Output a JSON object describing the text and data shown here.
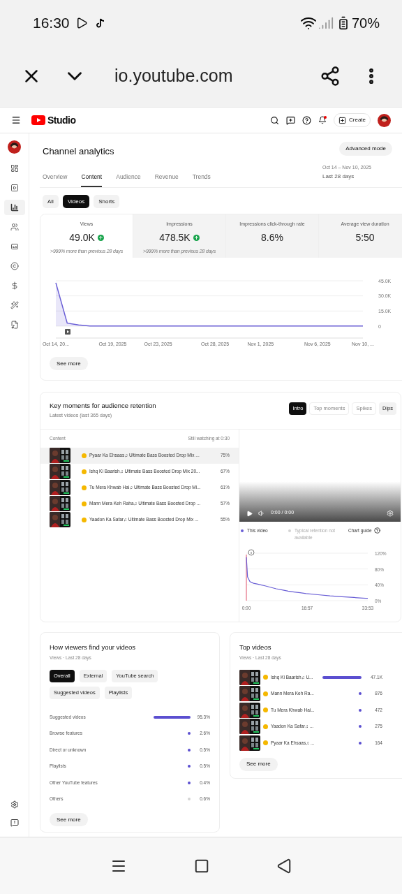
{
  "status_bar": {
    "time": "16:30",
    "battery": "70%"
  },
  "browser": {
    "url": "io.youtube.com"
  },
  "studio": {
    "logo": "Studio",
    "create": "Create"
  },
  "sidebar": {
    "items": [
      {
        "selected": false
      },
      {
        "selected": false
      },
      {
        "selected": true
      },
      {
        "selected": false
      },
      {
        "selected": false
      },
      {
        "selected": false
      },
      {
        "selected": false
      },
      {
        "selected": false
      },
      {
        "selected": false
      }
    ]
  },
  "page": {
    "title": "Channel analytics",
    "advanced": "Advanced mode",
    "date_range": "Oct 14 – Nov 10, 2025",
    "period": "Last 28 days"
  },
  "tabs": [
    {
      "label": "Overview",
      "selected": false
    },
    {
      "label": "Content",
      "selected": true
    },
    {
      "label": "Audience",
      "selected": false
    },
    {
      "label": "Revenue",
      "selected": false
    },
    {
      "label": "Trends",
      "selected": false
    }
  ],
  "filters": [
    {
      "label": "All",
      "selected": false
    },
    {
      "label": "Videos",
      "selected": true
    },
    {
      "label": "Shorts",
      "selected": false
    }
  ],
  "metrics": [
    {
      "label": "Views",
      "value": "49.0K",
      "up": true,
      "note": ">999% more than previous 28 days",
      "selected": true
    },
    {
      "label": "Impressions",
      "value": "478.5K",
      "up": true,
      "note": ">999% more than previous 28 days",
      "selected": false
    },
    {
      "label": "Impressions click-through rate",
      "value": "8.6%",
      "up": false,
      "selected": false
    },
    {
      "label": "Average view duration",
      "value": "5:50",
      "up": false,
      "selected": false
    }
  ],
  "views_chart": {
    "see_more": "See more",
    "chart_data": {
      "type": "area",
      "categories": [
        "Oct 14, 20...",
        null,
        null,
        null,
        null,
        "Oct 19, 2025",
        null,
        null,
        null,
        "Oct 23, 2025",
        null,
        null,
        null,
        null,
        "Oct 28, 2025",
        null,
        null,
        null,
        "Nov 1, 2025",
        null,
        null,
        null,
        null,
        "Nov 6, 2025",
        null,
        null,
        null,
        "Nov 10, ..."
      ],
      "series": [
        {
          "color": "#6a5fd6",
          "values": [
            43000,
            3000,
            1200,
            200,
            100,
            100,
            100,
            100,
            100,
            100,
            100,
            100,
            100,
            100,
            100,
            100,
            100,
            100,
            100,
            100,
            100,
            100,
            100,
            100,
            100,
            100,
            100,
            100
          ]
        }
      ],
      "ylim": [
        0,
        45000
      ],
      "yticks": [
        {
          "value": 0,
          "label": "0"
        },
        {
          "value": 15000,
          "label": "15.0K"
        },
        {
          "value": 30000,
          "label": "30.0K"
        },
        {
          "value": 45000,
          "label": "45.0K"
        }
      ]
    }
  },
  "retention": {
    "title": "Key moments for audience retention",
    "subtitle": "Latest videos (last 365 days)",
    "chips": [
      {
        "label": "Intro",
        "selected": true,
        "kind": "outlined"
      },
      {
        "label": "Top moments",
        "selected": false,
        "kind": "outlined"
      },
      {
        "label": "Spikes",
        "selected": false,
        "kind": "outlined"
      },
      {
        "label": "Dips",
        "selected": false,
        "kind": "filled"
      }
    ],
    "columns": [
      "Content",
      "Still watching at 0:30"
    ],
    "rows": [
      {
        "title": "Pyaar Ka Ehsaas♫ Ultimate Bass Boosted Drop Mix ...",
        "value": "75%",
        "selected": true
      },
      {
        "title": "Ishq Ki Baarish♫ Ultimate Bass Boosted Drop Mix 20...",
        "value": "67%",
        "selected": false
      },
      {
        "title": "Tu Mera Khwab Hai♫ Ultimate Bass Boosted Drop Mi...",
        "value": "61%",
        "selected": false
      },
      {
        "title": "Mann Mera Keh Raha♫ Ultimate Bass Boosted Drop ...",
        "value": "57%",
        "selected": false
      },
      {
        "title": "Yaadon Ka Safar♫ Ultimate Bass Boosted Drop Mix ...",
        "value": "55%",
        "selected": false
      }
    ],
    "player_time": "0:00 / 0:00",
    "legend_unavailable": "Typical retention not available",
    "chart_guide": "Chart guide",
    "chart_data": {
      "type": "line",
      "x": [
        0,
        20,
        60,
        120,
        180,
        240,
        300,
        400,
        500,
        600,
        700,
        800,
        900,
        1000,
        1200,
        1400,
        1600,
        1800,
        1900,
        2000,
        2033
      ],
      "series": [
        {
          "name": "This video",
          "color": "#6a5fd6",
          "values": [
            110,
            60,
            48,
            44,
            42,
            40,
            38,
            34,
            30,
            27,
            24,
            22,
            20,
            18,
            15,
            12,
            10,
            8,
            7,
            6,
            6
          ]
        }
      ],
      "ylim": [
        0,
        120
      ],
      "yticks": [
        {
          "value": 0,
          "label": "0%"
        },
        {
          "value": 40,
          "label": "40%"
        },
        {
          "value": 80,
          "label": "80%"
        },
        {
          "value": 120,
          "label": "120%"
        }
      ],
      "xlim": [
        0,
        2033
      ],
      "xticks": [
        {
          "value": 0,
          "label": "0:00"
        },
        {
          "value": 1017,
          "label": "16:57"
        },
        {
          "value": 2033,
          "label": "33:53"
        }
      ]
    }
  },
  "traffic": {
    "title": "How viewers find your videos",
    "subtitle": "Views · Last 28 days",
    "chips": [
      {
        "label": "Overall",
        "selected": true
      },
      {
        "label": "External",
        "selected": false
      },
      {
        "label": "YouTube search",
        "selected": false
      },
      {
        "label": "Suggested videos",
        "selected": false
      },
      {
        "label": "Playlists",
        "selected": false
      }
    ],
    "rows": [
      {
        "label": "Suggested videos",
        "value": "95.3%",
        "kind": "bar",
        "color": "#5b4fd0"
      },
      {
        "label": "Browse features",
        "value": "2.6%",
        "kind": "dot",
        "color": "#5b4fd0"
      },
      {
        "label": "Direct or unknown",
        "value": "0.5%",
        "kind": "dot",
        "color": "#5b4fd0"
      },
      {
        "label": "Playlists",
        "value": "0.5%",
        "kind": "dot",
        "color": "#5b4fd0"
      },
      {
        "label": "Other YouTube features",
        "value": "0.4%",
        "kind": "dot",
        "color": "#5b4fd0"
      },
      {
        "label": "Others",
        "value": "0.6%",
        "kind": "dot",
        "color": "#d4d4d4"
      }
    ],
    "see_more": "See more"
  },
  "top_videos": {
    "title": "Top videos",
    "subtitle": "Views · Last 28 days",
    "rows": [
      {
        "title": "Ishq Ki Baarish♫ U...",
        "value": "47.1K",
        "kind": "bar"
      },
      {
        "title": "Mann Mera Keh Ra...",
        "value": "876",
        "kind": "dot"
      },
      {
        "title": "Tu Mera Khwab Hai...",
        "value": "472",
        "kind": "dot"
      },
      {
        "title": "Yaadon Ka Safar♫ ...",
        "value": "275",
        "kind": "dot"
      },
      {
        "title": "Pyaar Ka Ehsaas♫ ...",
        "value": "164",
        "kind": "dot"
      }
    ],
    "see_more": "See more"
  }
}
